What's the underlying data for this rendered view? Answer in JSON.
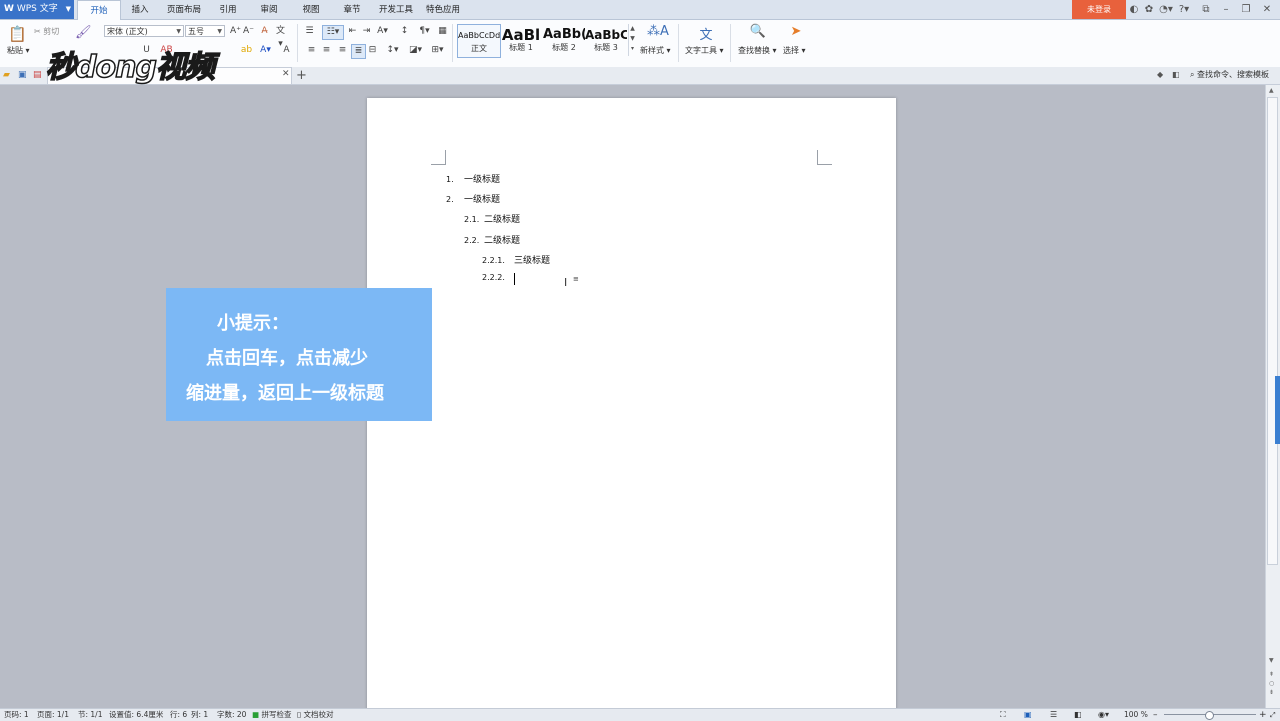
{
  "app": {
    "name": "WPS 文字",
    "login": "未登录"
  },
  "menu_tabs": [
    "开始",
    "插入",
    "页面布局",
    "引用",
    "审阅",
    "视图",
    "章节",
    "开发工具",
    "特色应用"
  ],
  "ribbon": {
    "paste": "粘贴",
    "cut": "剪切",
    "font_name": "宋体 (正文)",
    "font_size": "五号",
    "styles": [
      {
        "preview": "AaBbCcDd",
        "label": "正文"
      },
      {
        "preview": "AaBl",
        "label": "标题 1"
      },
      {
        "preview": "AaBb(",
        "label": "标题 2"
      },
      {
        "preview": "AaBbC",
        "label": "标题 3"
      }
    ],
    "new_style": "新样式",
    "text_tools": "文字工具",
    "find_replace": "查找替换",
    "select": "选择"
  },
  "tabbar": {
    "search": "查找命令、搜索模板"
  },
  "brand": "秒dong视频",
  "document": {
    "outline": [
      {
        "num": "1.",
        "text": "一级标题"
      },
      {
        "num": "2.",
        "text": "一级标题"
      },
      {
        "num": "2.1.",
        "text": "二级标题"
      },
      {
        "num": "2.2.",
        "text": "二级标题"
      },
      {
        "num": "2.2.1.",
        "text": "三级标题"
      },
      {
        "num": "2.2.2.",
        "text": ""
      }
    ]
  },
  "tip": {
    "title": "小提示：",
    "line1": "点击回车，点击减少",
    "line2": "缩进量，返回上一级标题"
  },
  "status": {
    "page_num": "页码: 1",
    "pages": "页面: 1/1",
    "section": "节: 1/1",
    "setting": "设置值: 6.4厘米",
    "row": "行: 6",
    "col": "列: 1",
    "words": "字数: 20",
    "spell": "拼写检查",
    "proof": "文档校对",
    "zoom": "100 %"
  }
}
